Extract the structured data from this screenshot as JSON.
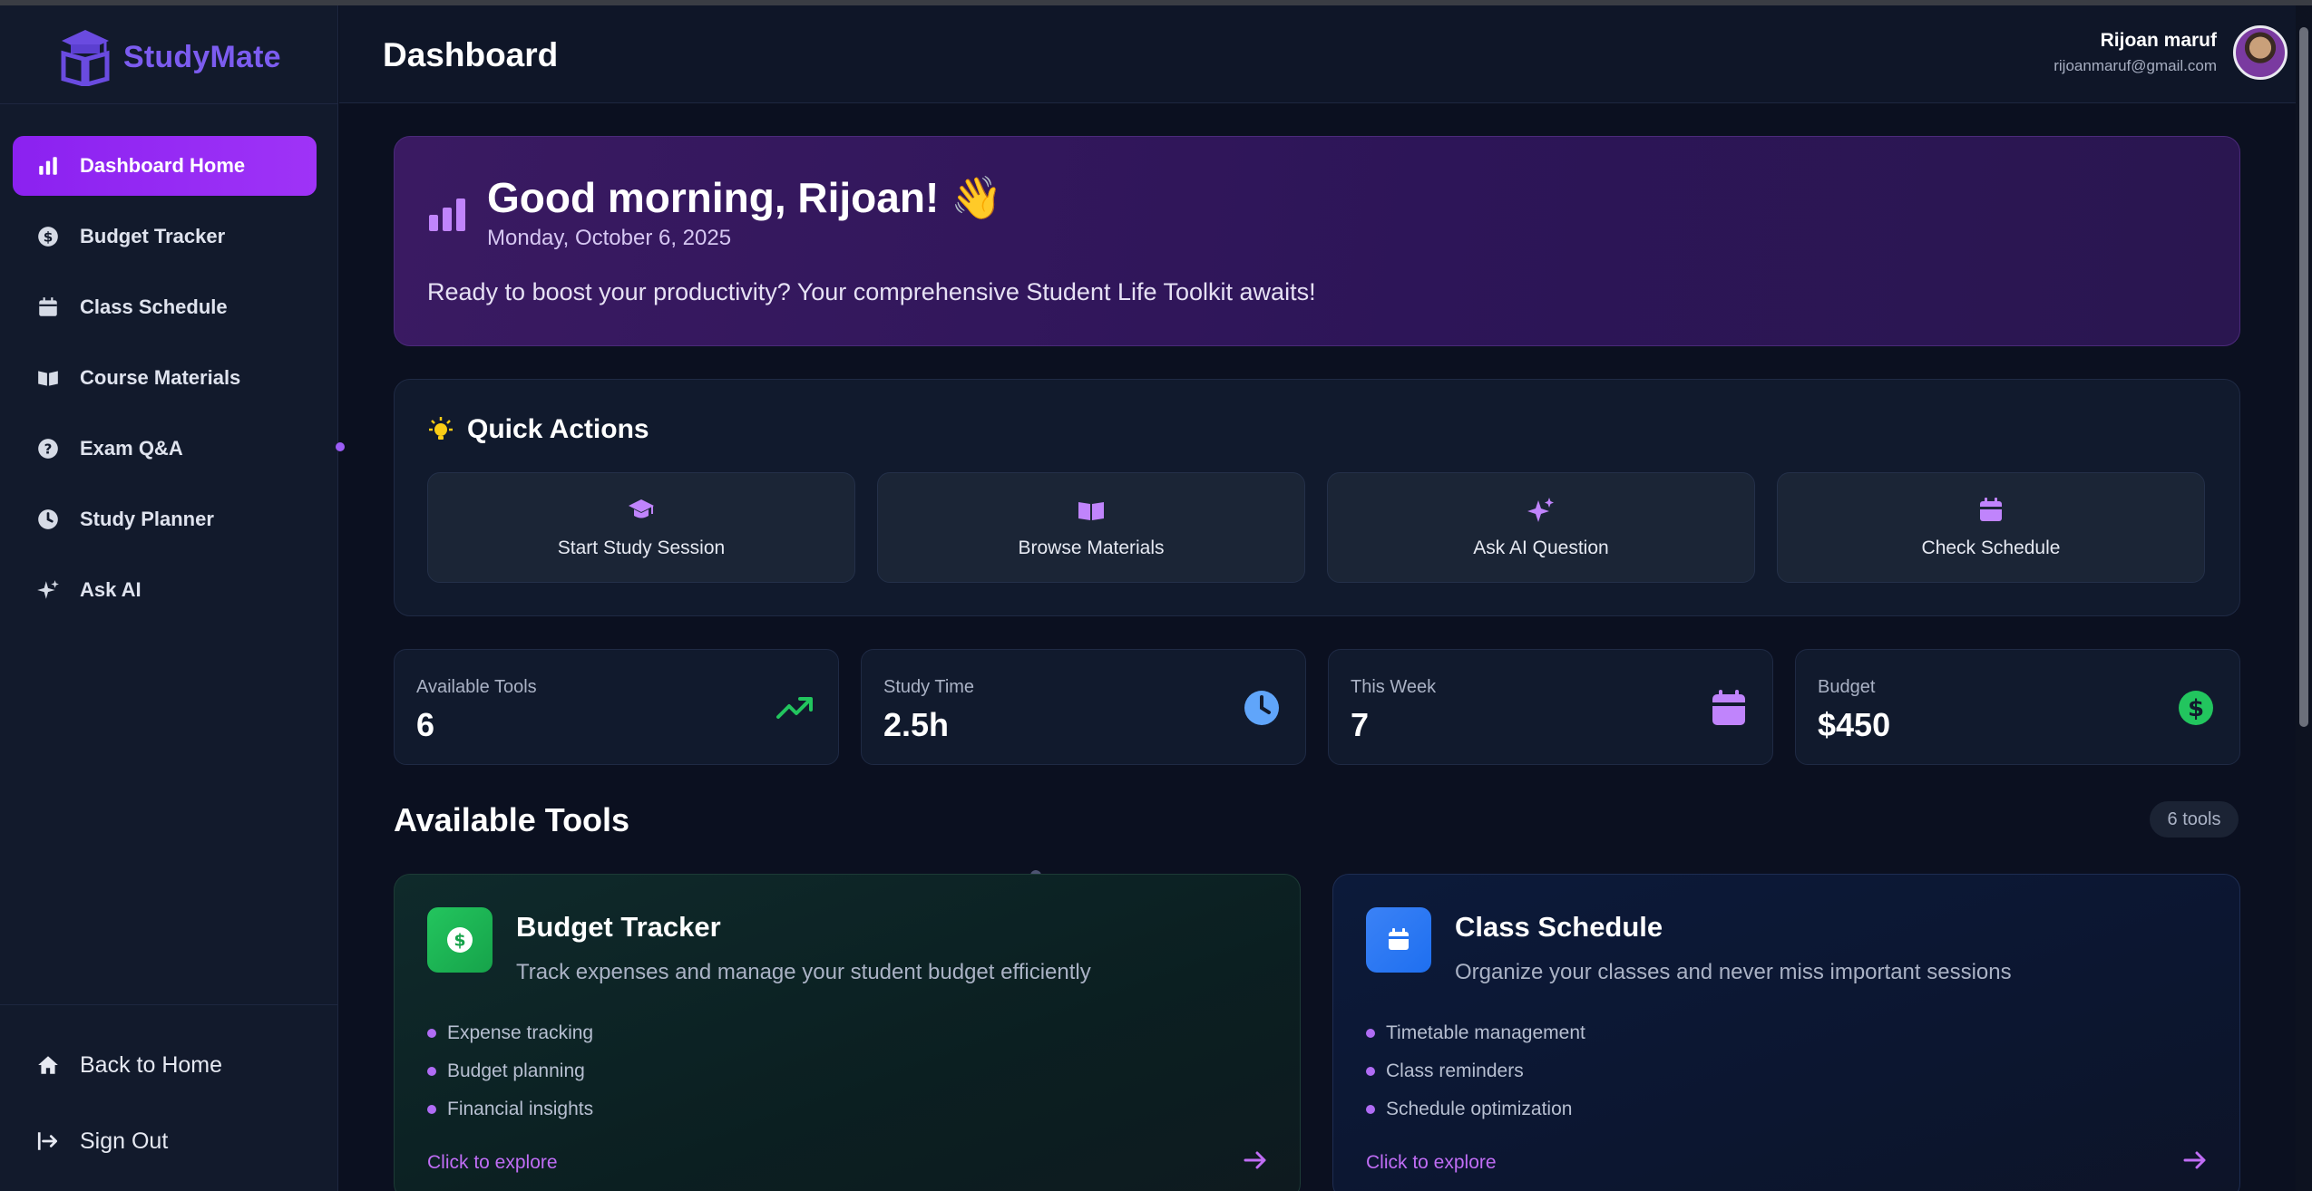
{
  "brand": {
    "name": "StudyMate"
  },
  "sidebar": {
    "items": [
      {
        "label": "Dashboard Home",
        "icon": "bar-chart-icon",
        "active": true
      },
      {
        "label": "Budget Tracker",
        "icon": "dollar-circle-icon"
      },
      {
        "label": "Class Schedule",
        "icon": "calendar-icon"
      },
      {
        "label": "Course Materials",
        "icon": "book-open-icon"
      },
      {
        "label": "Exam Q&A",
        "icon": "question-circle-icon"
      },
      {
        "label": "Study Planner",
        "icon": "clock-icon"
      },
      {
        "label": "Ask AI",
        "icon": "sparkles-icon"
      }
    ],
    "bottom": [
      {
        "label": "Back to Home",
        "icon": "home-icon"
      },
      {
        "label": "Sign Out",
        "icon": "sign-out-icon"
      }
    ]
  },
  "header": {
    "title": "Dashboard",
    "user": {
      "name": "Rijoan maruf",
      "email": "rijoanmaruf@gmail.com"
    }
  },
  "welcome": {
    "title": "Good morning, Rijoan! 👋",
    "date": "Monday, October 6, 2025",
    "message": "Ready to boost your productivity? Your comprehensive Student Life Toolkit awaits!"
  },
  "quick_actions": {
    "title": "Quick Actions",
    "buttons": [
      {
        "label": "Start Study Session",
        "icon": "graduation-cap-icon"
      },
      {
        "label": "Browse Materials",
        "icon": "book-open-icon"
      },
      {
        "label": "Ask AI Question",
        "icon": "sparkles-icon"
      },
      {
        "label": "Check Schedule",
        "icon": "calendar-icon"
      }
    ]
  },
  "stats": [
    {
      "label": "Available Tools",
      "value": "6",
      "icon": "trending-up-icon",
      "color": "#22c55e"
    },
    {
      "label": "Study Time",
      "value": "2.5h",
      "icon": "clock-icon",
      "color": "#60a5fa"
    },
    {
      "label": "This Week",
      "value": "7",
      "icon": "calendar-icon",
      "color": "#c084fc"
    },
    {
      "label": "Budget",
      "value": "$450",
      "icon": "dollar-circle-icon",
      "color": "#22c55e"
    }
  ],
  "tools": {
    "title": "Available Tools",
    "count_badge": "6 tools",
    "cards": [
      {
        "name": "Budget Tracker",
        "description": "Track expenses and manage your student budget efficiently",
        "features": [
          "Expense tracking",
          "Budget planning",
          "Financial insights"
        ],
        "cta": "Click to explore",
        "icon": "dollar-circle-icon"
      },
      {
        "name": "Class Schedule",
        "description": "Organize your classes and never miss important sessions",
        "features": [
          "Timetable management",
          "Class reminders",
          "Schedule optimization"
        ],
        "cta": "Click to explore",
        "icon": "calendar-icon"
      }
    ]
  },
  "colors": {
    "accent": "#8b21f0",
    "brand": "#7c5cf0",
    "background": "#0b1020",
    "sidebar": "#121a2c"
  }
}
